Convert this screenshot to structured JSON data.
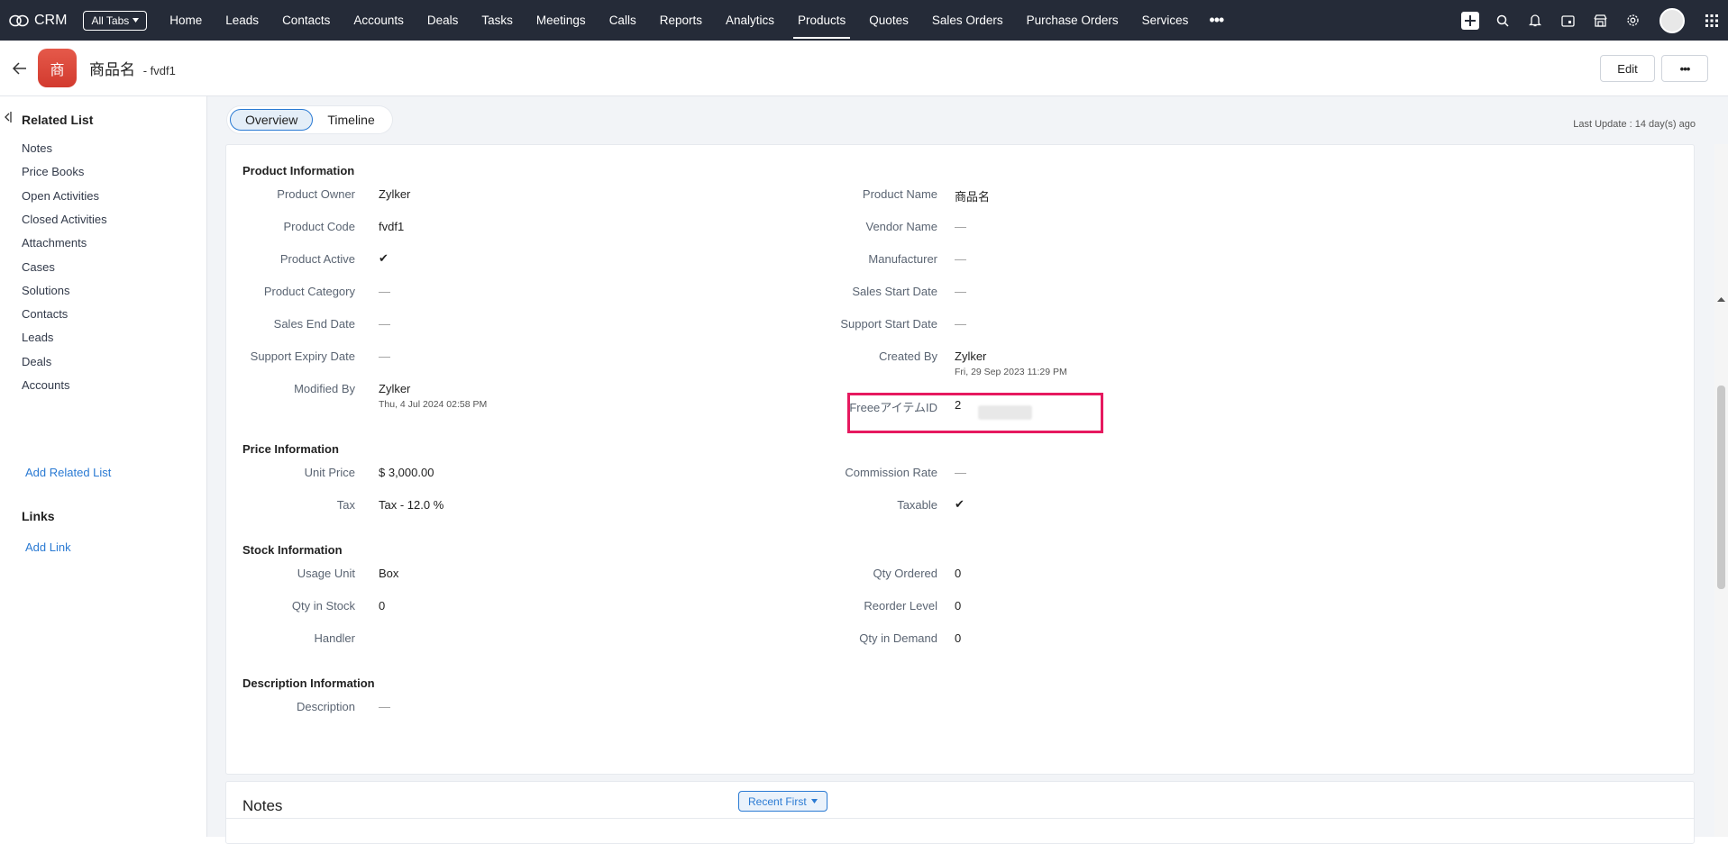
{
  "nav": {
    "brand": "CRM",
    "all_tabs": "All Tabs",
    "tabs": [
      "Home",
      "Leads",
      "Contacts",
      "Accounts",
      "Deals",
      "Tasks",
      "Meetings",
      "Calls",
      "Reports",
      "Analytics",
      "Products",
      "Quotes",
      "Sales Orders",
      "Purchase Orders",
      "Services"
    ],
    "active_tab": "Products",
    "more": "•••"
  },
  "header": {
    "avatar_text": "商",
    "title": "商品名",
    "subtitle": "- fvdf1",
    "edit_label": "Edit",
    "more_label": "•••"
  },
  "sidebar": {
    "related_heading": "Related List",
    "items": [
      "Notes",
      "Price Books",
      "Open Activities",
      "Closed Activities",
      "Attachments",
      "Cases",
      "Solutions",
      "Contacts",
      "Leads",
      "Deals",
      "Accounts"
    ],
    "add_related": "Add Related List",
    "links_heading": "Links",
    "add_link": "Add Link"
  },
  "tabs": {
    "overview": "Overview",
    "timeline": "Timeline"
  },
  "last_update": "Last Update : 14 day(s) ago",
  "sections": {
    "product": "Product Information",
    "price": "Price Information",
    "stock": "Stock Information",
    "description": "Description Information"
  },
  "fields": {
    "product_owner": {
      "label": "Product Owner",
      "value": "Zylker"
    },
    "product_name": {
      "label": "Product Name",
      "value": "商品名"
    },
    "product_code": {
      "label": "Product Code",
      "value": "fvdf1"
    },
    "vendor_name": {
      "label": "Vendor Name",
      "value": "—"
    },
    "product_active": {
      "label": "Product Active",
      "value": "✔"
    },
    "manufacturer": {
      "label": "Manufacturer",
      "value": "—"
    },
    "product_category": {
      "label": "Product Category",
      "value": "—"
    },
    "sales_start_date": {
      "label": "Sales Start Date",
      "value": "—"
    },
    "sales_end_date": {
      "label": "Sales End Date",
      "value": "—"
    },
    "support_start_date": {
      "label": "Support Start Date",
      "value": "—"
    },
    "support_expiry_date": {
      "label": "Support Expiry Date",
      "value": "—"
    },
    "created_by": {
      "label": "Created By",
      "value": "Zylker",
      "sub": "Fri, 29 Sep 2023 11:29 PM"
    },
    "modified_by": {
      "label": "Modified By",
      "value": "Zylker",
      "sub": "Thu, 4 Jul 2024 02:58 PM"
    },
    "freee_item_id": {
      "label": "FreeeアイテムID",
      "value": "2"
    },
    "unit_price": {
      "label": "Unit Price",
      "value": "$ 3,000.00"
    },
    "commission_rate": {
      "label": "Commission Rate",
      "value": "—"
    },
    "tax": {
      "label": "Tax",
      "value": "Tax - 12.0 %"
    },
    "taxable": {
      "label": "Taxable",
      "value": "✔"
    },
    "usage_unit": {
      "label": "Usage Unit",
      "value": "Box"
    },
    "qty_ordered": {
      "label": "Qty Ordered",
      "value": "0"
    },
    "qty_in_stock": {
      "label": "Qty in Stock",
      "value": "0"
    },
    "reorder_level": {
      "label": "Reorder Level",
      "value": "0"
    },
    "handler": {
      "label": "Handler",
      "value": ""
    },
    "qty_in_demand": {
      "label": "Qty in Demand",
      "value": "0"
    },
    "description": {
      "label": "Description",
      "value": "—"
    }
  },
  "notes": {
    "title": "Notes",
    "sort_label": "Recent First"
  },
  "colors": {
    "nav_bg": "#252b38",
    "accent": "#2a7ad3",
    "highlight": "#e6195f",
    "avatar": "#d9432f"
  }
}
